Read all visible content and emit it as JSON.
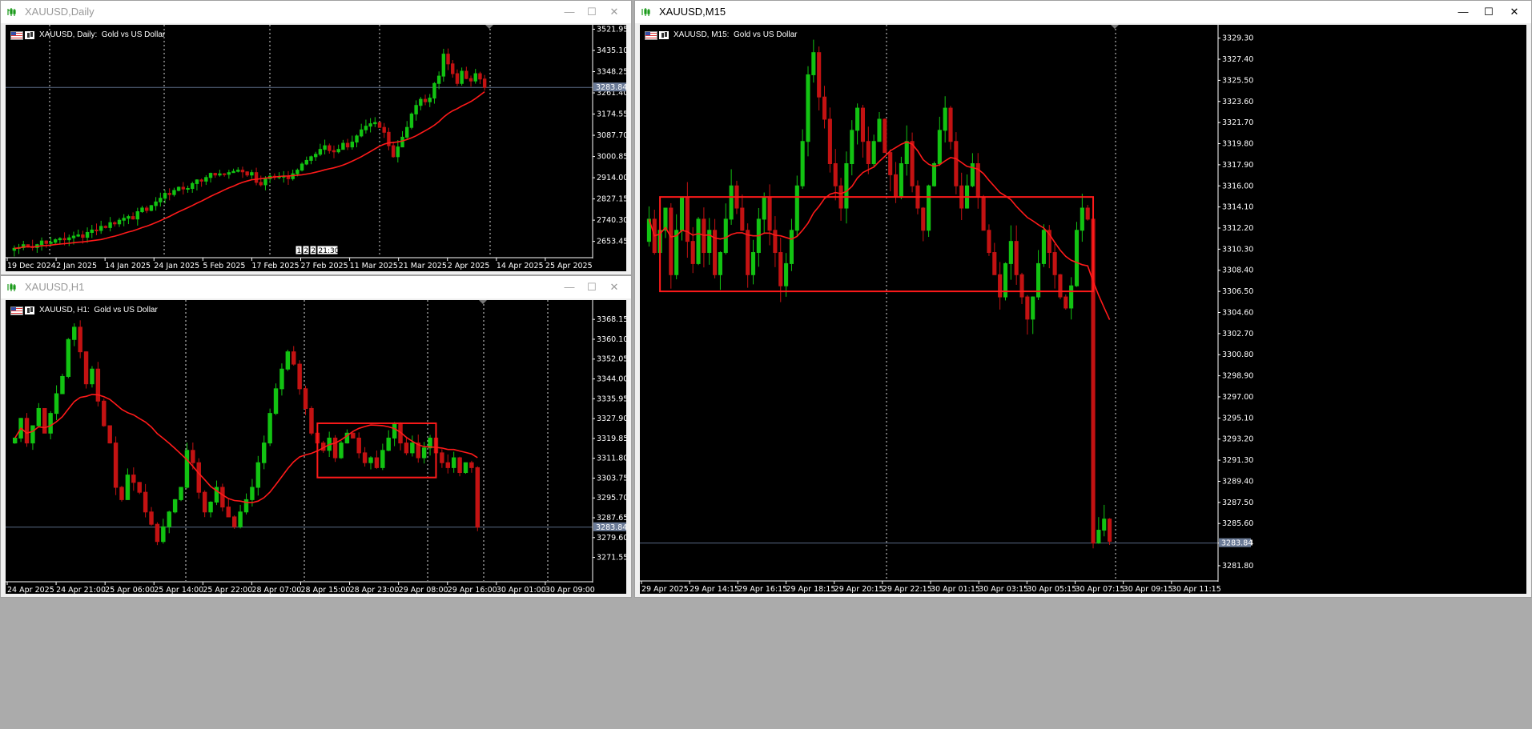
{
  "windows": {
    "daily": {
      "title": "XAUUSD,Daily",
      "chart_title": "XAUUSD, Daily:  Gold vs US Dollar",
      "current_price": "3283.84",
      "period_indicator": "1",
      "period_tag": "2",
      "period_box": "2",
      "countdown": "21:30"
    },
    "h1": {
      "title": "XAUUSD,H1",
      "chart_title": "XAUUSD, H1:  Gold vs US Dollar",
      "current_price": "3283.84"
    },
    "m15": {
      "title": "XAUUSD,M15",
      "chart_title": "XAUUSD, M15:  Gold vs US Dollar",
      "current_price": "3283.84"
    }
  },
  "window_controls": {
    "minimize": "—",
    "maximize": "☐",
    "close": "✕"
  },
  "colors": {
    "bull": "#12c312",
    "bear": "#c31212",
    "ma": "#ff1a1a",
    "box": "#ff1a1a",
    "bid_line": "#5a6a86",
    "grid": "#cccccc"
  },
  "chart_data": [
    {
      "type": "candlestick",
      "symbol": "XAUUSD",
      "timeframe": "Daily",
      "ylim": [
        2590,
        3540
      ],
      "price_ticks": [
        "3521.95",
        "3435.10",
        "3348.25",
        "3261.40",
        "3174.55",
        "3087.70",
        "3000.85",
        "2914.00",
        "2827.15",
        "2740.30",
        "2653.45"
      ],
      "time_ticks": [
        "19 Dec 2024",
        "2 Jan 2025",
        "14 Jan 2025",
        "24 Jan 2025",
        "5 Feb 2025",
        "17 Feb 2025",
        "27 Feb 2025",
        "11 Mar 2025",
        "21 Mar 2025",
        "2 Apr 2025",
        "14 Apr 2025",
        "25 Apr 2025"
      ],
      "bid": 3283.84,
      "ma_period_hint": "moving average (red)",
      "closes": [
        2625,
        2628,
        2640,
        2632,
        2628,
        2640,
        2655,
        2645,
        2650,
        2660,
        2665,
        2660,
        2668,
        2675,
        2680,
        2670,
        2690,
        2700,
        2698,
        2715,
        2710,
        2730,
        2725,
        2740,
        2748,
        2755,
        2745,
        2775,
        2790,
        2780,
        2800,
        2815,
        2830,
        2850,
        2845,
        2862,
        2875,
        2868,
        2870,
        2890,
        2905,
        2900,
        2915,
        2932,
        2925,
        2930,
        2928,
        2935,
        2940,
        2945,
        2938,
        2925,
        2935,
        2895,
        2885,
        2910,
        2920,
        2915,
        2918,
        2920,
        2910,
        2930,
        2945,
        2970,
        2985,
        3000,
        3010,
        3030,
        3045,
        3025,
        3020,
        3030,
        3055,
        3040,
        3060,
        3085,
        3110,
        3125,
        3135,
        3140,
        3120,
        3100,
        3045,
        3000,
        3040,
        3080,
        3120,
        3175,
        3210,
        3235,
        3225,
        3240,
        3300,
        3330,
        3420,
        3380,
        3340,
        3300,
        3350,
        3320,
        3310,
        3340,
        3318,
        3283.84
      ]
    },
    {
      "type": "candlestick",
      "symbol": "XAUUSD",
      "timeframe": "H1",
      "ylim": [
        3262,
        3376
      ],
      "price_ticks": [
        "3368.15",
        "3360.10",
        "3352.05",
        "3344.00",
        "3335.95",
        "3327.90",
        "3319.85",
        "3311.80",
        "3303.75",
        "3295.70",
        "3287.65",
        "3279.60",
        "3271.55"
      ],
      "time_ticks": [
        "24 Apr 2025",
        "24 Apr 21:00",
        "25 Apr 06:00",
        "25 Apr 14:00",
        "25 Apr 22:00",
        "28 Apr 07:00",
        "28 Apr 15:00",
        "28 Apr 23:00",
        "29 Apr 08:00",
        "29 Apr 16:00",
        "30 Apr 01:00",
        "30 Apr 09:00"
      ],
      "bid": 3283.84,
      "box": {
        "price_top": 3326,
        "price_bottom": 3304
      },
      "closes": [
        3320,
        3328,
        3318,
        3325,
        3332,
        3322,
        3330,
        3338,
        3345,
        3360,
        3365,
        3355,
        3342,
        3348,
        3335,
        3325,
        3318,
        3300,
        3295,
        3305,
        3302,
        3298,
        3290,
        3285,
        3278,
        3284,
        3290,
        3295,
        3300,
        3315,
        3310,
        3298,
        3290,
        3294,
        3300,
        3292,
        3288,
        3284,
        3290,
        3295,
        3300,
        3310,
        3318,
        3330,
        3340,
        3348,
        3355,
        3350,
        3340,
        3332,
        3322,
        3318,
        3315,
        3320,
        3312,
        3318,
        3322,
        3320,
        3314,
        3310,
        3312,
        3308,
        3315,
        3320,
        3326,
        3318,
        3314,
        3318,
        3312,
        3316,
        3320,
        3314,
        3310,
        3308,
        3312,
        3306,
        3310,
        3308,
        3283.84
      ]
    },
    {
      "type": "candlestick",
      "symbol": "XAUUSD",
      "timeframe": "M15",
      "ylim": [
        3280.5,
        3330.5
      ],
      "price_ticks": [
        "3329.30",
        "3327.40",
        "3325.50",
        "3323.60",
        "3321.70",
        "3319.80",
        "3317.90",
        "3316.00",
        "3314.10",
        "3312.20",
        "3310.30",
        "3308.40",
        "3306.50",
        "3304.60",
        "3302.70",
        "3300.80",
        "3298.90",
        "3297.00",
        "3295.10",
        "3293.20",
        "3291.30",
        "3289.40",
        "3287.50",
        "3285.60",
        "3283.84",
        "3281.80"
      ],
      "time_ticks": [
        "29 Apr 2025",
        "29 Apr 14:15",
        "29 Apr 16:15",
        "29 Apr 18:15",
        "29 Apr 20:15",
        "29 Apr 22:15",
        "30 Apr 01:15",
        "30 Apr 03:15",
        "30 Apr 05:15",
        "30 Apr 07:15",
        "30 Apr 09:15",
        "30 Apr 11:15"
      ],
      "bid": 3283.84,
      "box": {
        "price_top": 3315,
        "price_bottom": 3306.5
      },
      "closes": [
        3313,
        3310,
        3312,
        3314,
        3308,
        3312,
        3315,
        3311,
        3309,
        3313,
        3310,
        3312,
        3308,
        3310,
        3313,
        3316,
        3314,
        3312,
        3308,
        3310,
        3313,
        3315,
        3312,
        3310,
        3307,
        3309,
        3312,
        3316,
        3320,
        3326,
        3328,
        3324,
        3322,
        3318,
        3316,
        3314,
        3318,
        3321,
        3323,
        3320,
        3318,
        3320,
        3322,
        3319,
        3317,
        3315,
        3318,
        3320,
        3316,
        3314,
        3312,
        3316,
        3318,
        3321,
        3323,
        3320,
        3316,
        3314,
        3316,
        3318,
        3315,
        3312,
        3310,
        3308,
        3306,
        3309,
        3311,
        3308,
        3306,
        3304,
        3306,
        3309,
        3312,
        3310,
        3308,
        3306,
        3305,
        3307,
        3312,
        3314,
        3313,
        3283.84,
        3285,
        3286,
        3284
      ]
    }
  ]
}
